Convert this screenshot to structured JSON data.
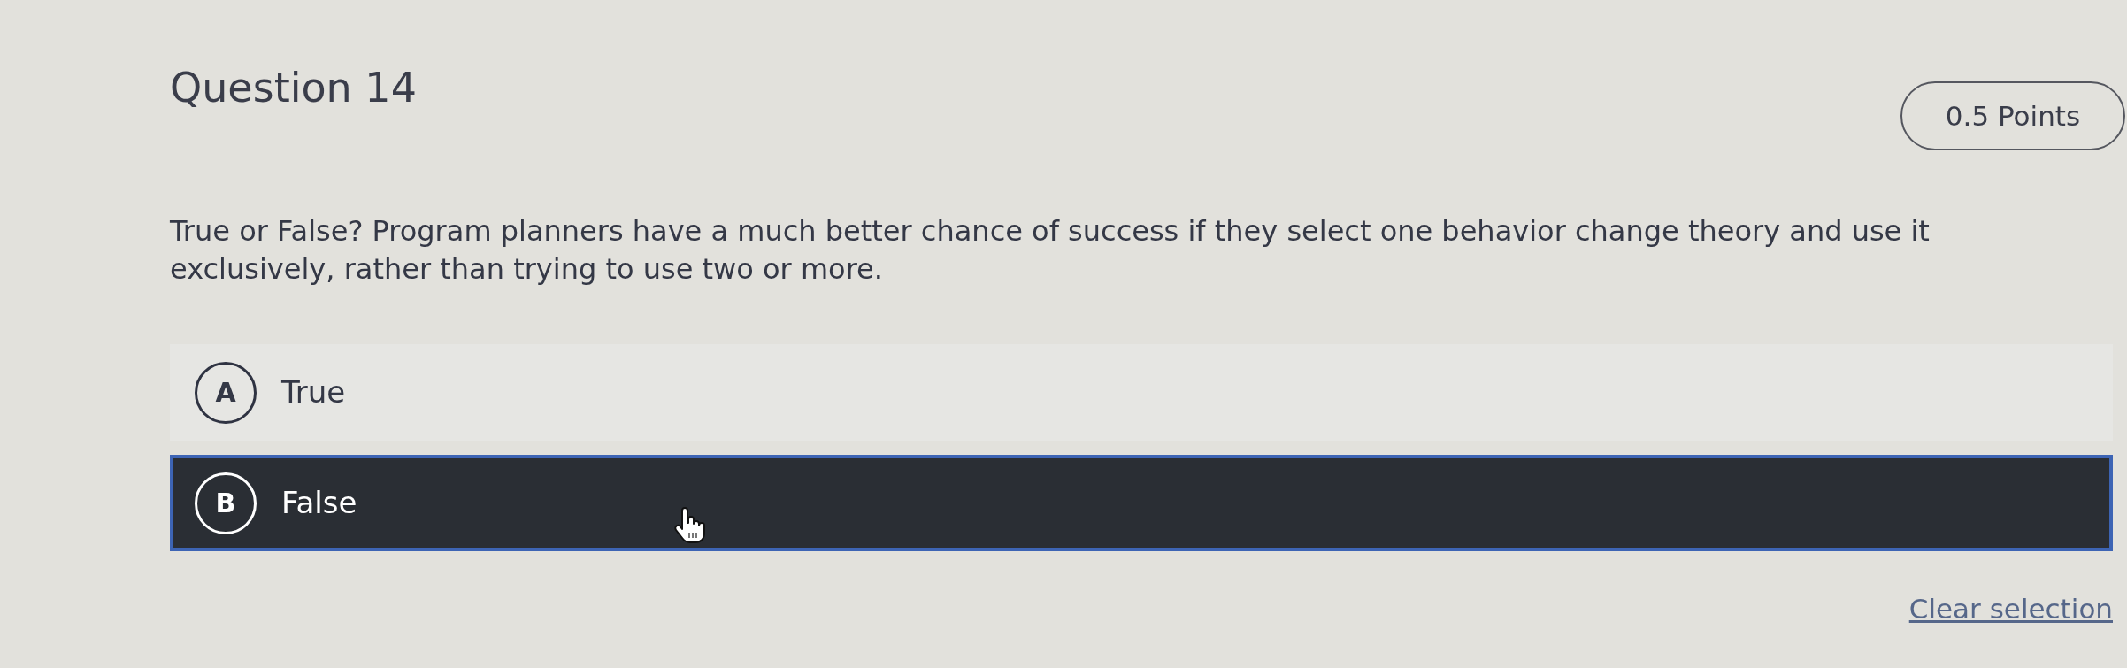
{
  "question": {
    "title": "Question 14",
    "points": "0.5 Points",
    "prompt": "True or False? Program planners have a much better chance of success if they select one behavior change theory and use it exclusively, rather than trying to use two or more."
  },
  "options": [
    {
      "letter": "A",
      "label": "True",
      "selected": false
    },
    {
      "letter": "B",
      "label": "False",
      "selected": true
    }
  ],
  "clear_selection": "Clear selection"
}
